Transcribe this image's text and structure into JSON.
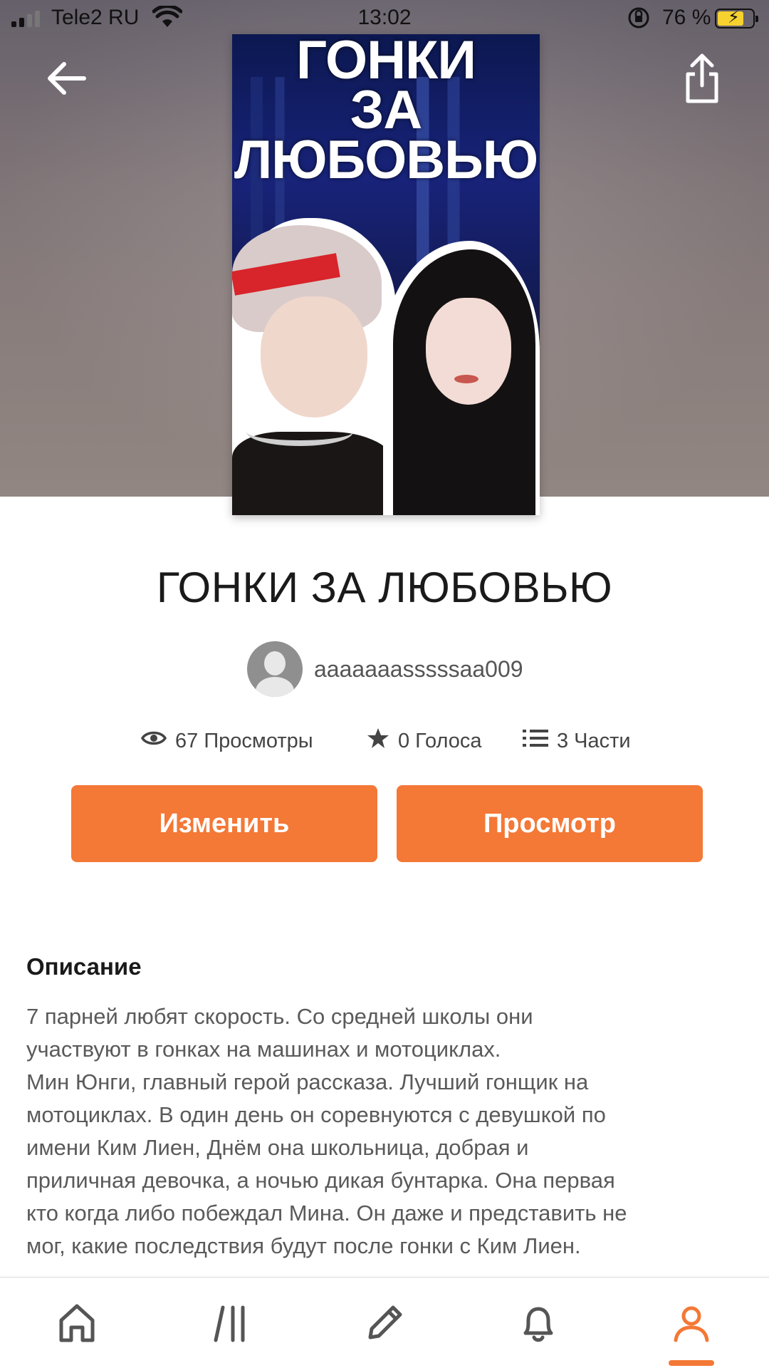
{
  "status_bar": {
    "carrier": "Tele2 RU",
    "time": "13:02",
    "battery_percent": "76 %",
    "battery_level": 0.76,
    "icons": [
      "signal-icon",
      "wifi-icon",
      "rotation-lock-icon",
      "battery-charging-icon"
    ]
  },
  "header": {
    "back_icon": "arrow-left-icon",
    "share_icon": "share-icon"
  },
  "cover": {
    "title_lines": [
      "ГОНКИ",
      "ЗА",
      "ЛЮБОВЬЮ"
    ]
  },
  "story": {
    "title": "ГОНКИ ЗА ЛЮБОВЬЮ",
    "author": "aaaaaaasssssaa009"
  },
  "stats": {
    "views": "67 Просмотры",
    "votes": "0 Голоса",
    "parts": "3 Части"
  },
  "actions": {
    "edit_label": "Изменить",
    "view_label": "Просмотр"
  },
  "description": {
    "heading": "Описание",
    "text": "7 парней любят скорость. Со средней школы они\nучаствуют в гонках на машинах и мотоциклах.\nМин Юнги, главный герой рассказа. Лучший гонщик на\nмотоциклах. В один день он соревнуются с девушкой по\nимени Ким Лиен, Днём она школьница, добрая и\nприличная девочка, а ночью дикая бунтарка. Она первая\nкто когда либо побеждал  Мина. Он даже и представить не\nмог, какие последствия будут после гонки с Ким Лиен."
  },
  "bottom_nav": {
    "items": [
      "home-icon",
      "library-icon",
      "write-icon",
      "notifications-icon",
      "profile-icon"
    ],
    "active": "profile-icon"
  },
  "colors": {
    "accent": "#f47836",
    "text_primary": "#1a1a1a",
    "text_secondary": "#5a5a5a"
  }
}
